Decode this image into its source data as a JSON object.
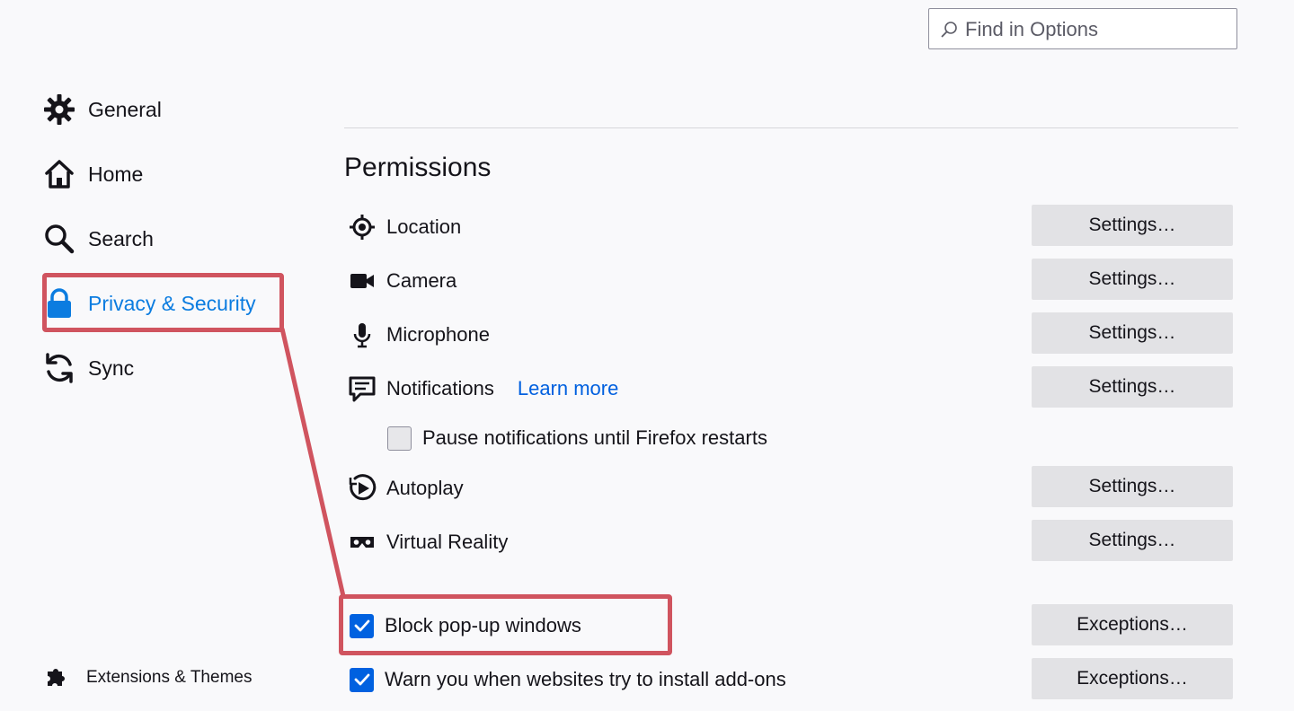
{
  "search": {
    "placeholder": "Find in Options"
  },
  "sidebar": {
    "items": [
      {
        "label": "General",
        "icon": "gear-icon"
      },
      {
        "label": "Home",
        "icon": "home-icon"
      },
      {
        "label": "Search",
        "icon": "search-icon"
      },
      {
        "label": "Privacy & Security",
        "icon": "lock-icon",
        "selected": true
      },
      {
        "label": "Sync",
        "icon": "sync-icon"
      }
    ],
    "extensions": {
      "label": "Extensions & Themes",
      "icon": "puzzle-icon"
    }
  },
  "permissions": {
    "title": "Permissions",
    "rows": [
      {
        "label": "Location",
        "icon": "location-icon",
        "button": "Settings…"
      },
      {
        "label": "Camera",
        "icon": "camera-icon",
        "button": "Settings…"
      },
      {
        "label": "Microphone",
        "icon": "microphone-icon",
        "button": "Settings…"
      },
      {
        "label": "Notifications",
        "icon": "notification-icon",
        "button": "Settings…",
        "link": "Learn more"
      },
      {
        "label": "Autoplay",
        "icon": "autoplay-icon",
        "button": "Settings…"
      },
      {
        "label": "Virtual Reality",
        "icon": "vr-icon",
        "button": "Settings…"
      }
    ],
    "pause_notifications": {
      "label": "Pause notifications until Firefox restarts",
      "checked": false
    },
    "block_popups": {
      "label": "Block pop-up windows",
      "checked": true,
      "button": "Exceptions…"
    },
    "warn_addons": {
      "label": "Warn you when websites try to install add-ons",
      "checked": true,
      "button": "Exceptions…"
    }
  },
  "colors": {
    "accent": "#0061e0",
    "selected_nav": "#0b7ce0",
    "annotation": "#d0545f"
  }
}
